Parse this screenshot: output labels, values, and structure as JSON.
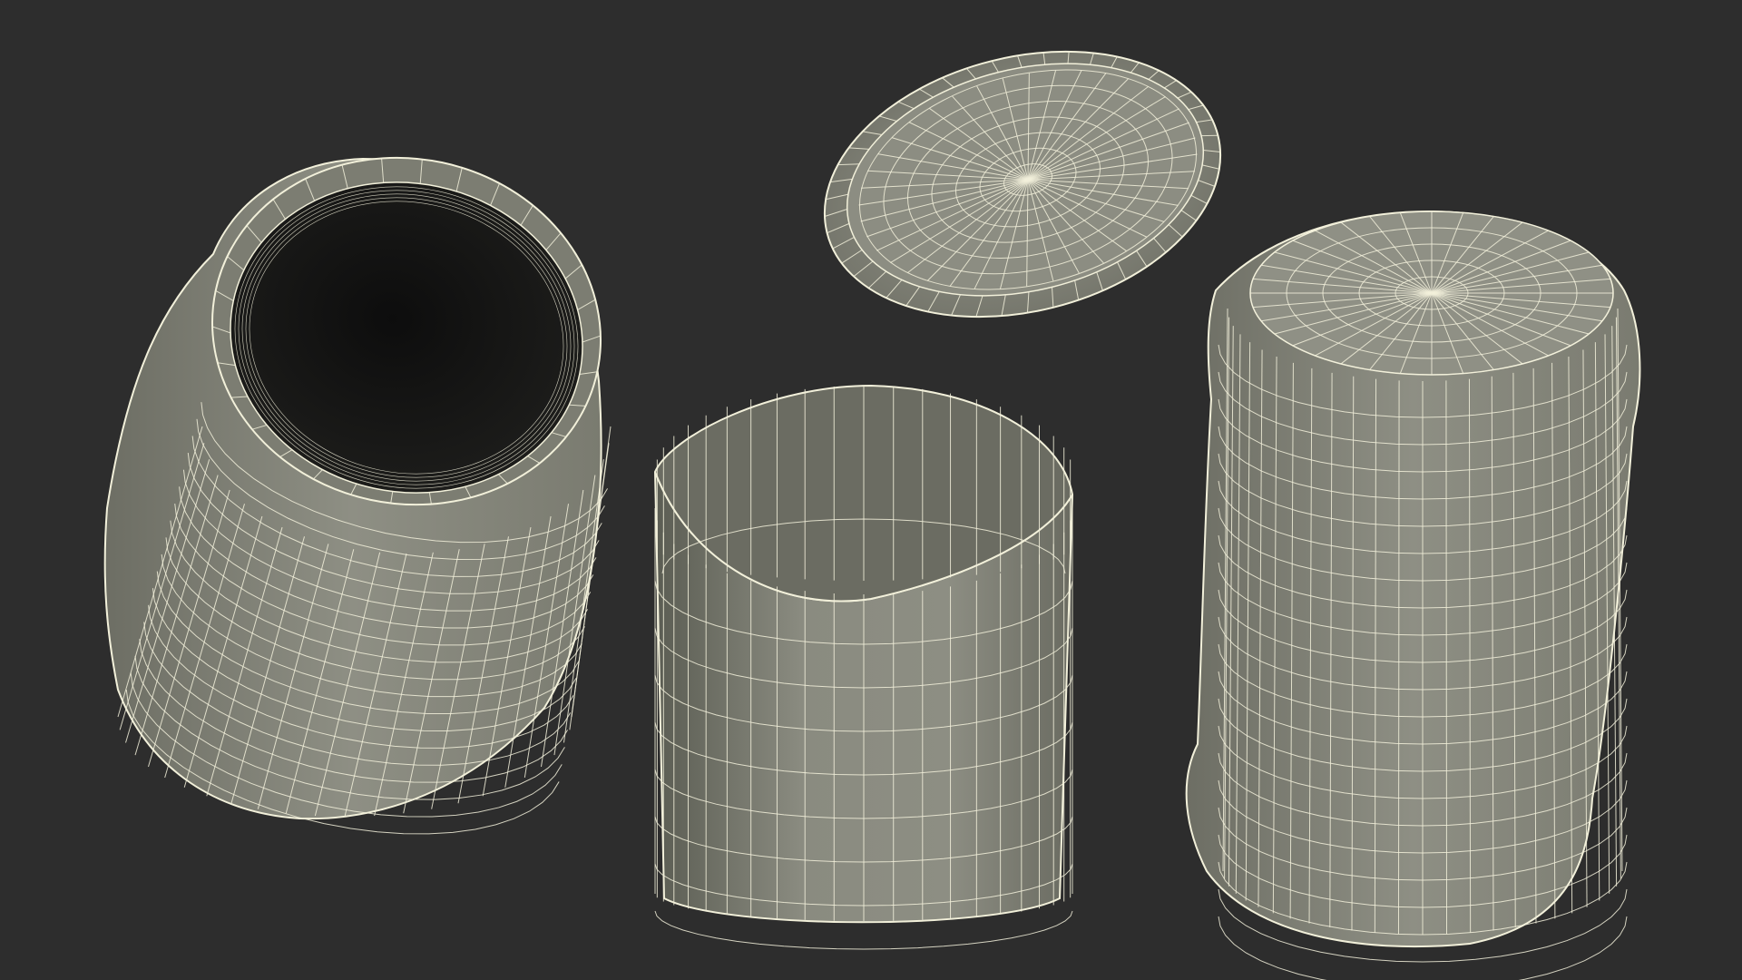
{
  "scene": {
    "background_color": "#2d2d2d",
    "mesh_surface_color": "#828377",
    "mesh_dark_color": "#585a50",
    "wire_color": "#f2f0da",
    "interior_color": "#111111",
    "objects": [
      {
        "name": "jar-body-open",
        "kind": "jar, tilted, open mouth"
      },
      {
        "name": "lid",
        "kind": "lid, underside up"
      },
      {
        "name": "label-sleeve",
        "kind": "open cylinder"
      },
      {
        "name": "jar-body-closed",
        "kind": "jar, inverted"
      }
    ]
  }
}
